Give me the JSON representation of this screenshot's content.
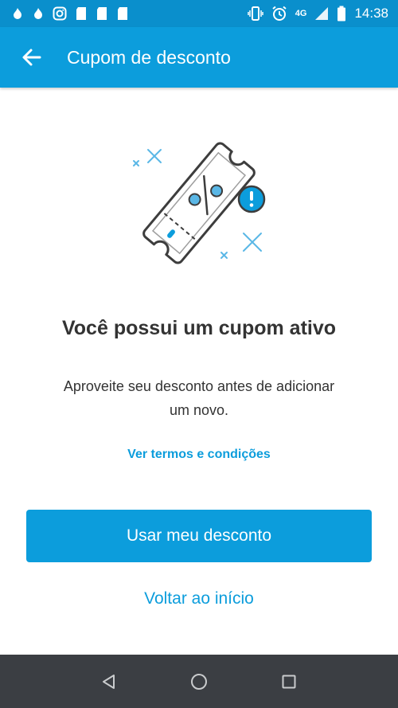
{
  "status_bar": {
    "time": "14:38",
    "network": "4G",
    "left_icons": [
      "flame-icon",
      "flame-icon",
      "instagram-icon",
      "sd-card-icon",
      "sd-card-icon",
      "sd-card-icon"
    ],
    "right_icons": [
      "vibrate-icon",
      "alarm-icon",
      "signal-icon",
      "battery-icon"
    ]
  },
  "app_bar": {
    "title": "Cupom de desconto",
    "back_icon": "arrow-left-icon"
  },
  "content": {
    "illustration": "coupon-ticket-icon",
    "headline": "Você possui um cupom ativo",
    "body_line1": "Aproveite seu desconto antes de adicionar",
    "body_line2": "um novo.",
    "terms_link": "Ver termos e condições",
    "primary_button": "Usar meu desconto",
    "secondary_link": "Voltar ao início"
  },
  "nav_bar": {
    "icons": [
      "back-triangle-icon",
      "home-circle-icon",
      "recents-square-icon"
    ]
  },
  "colors": {
    "primary": "#0c9ddc",
    "status_bar": "#0a8fcc",
    "nav_bar": "#3b3e43",
    "text": "#333333"
  }
}
